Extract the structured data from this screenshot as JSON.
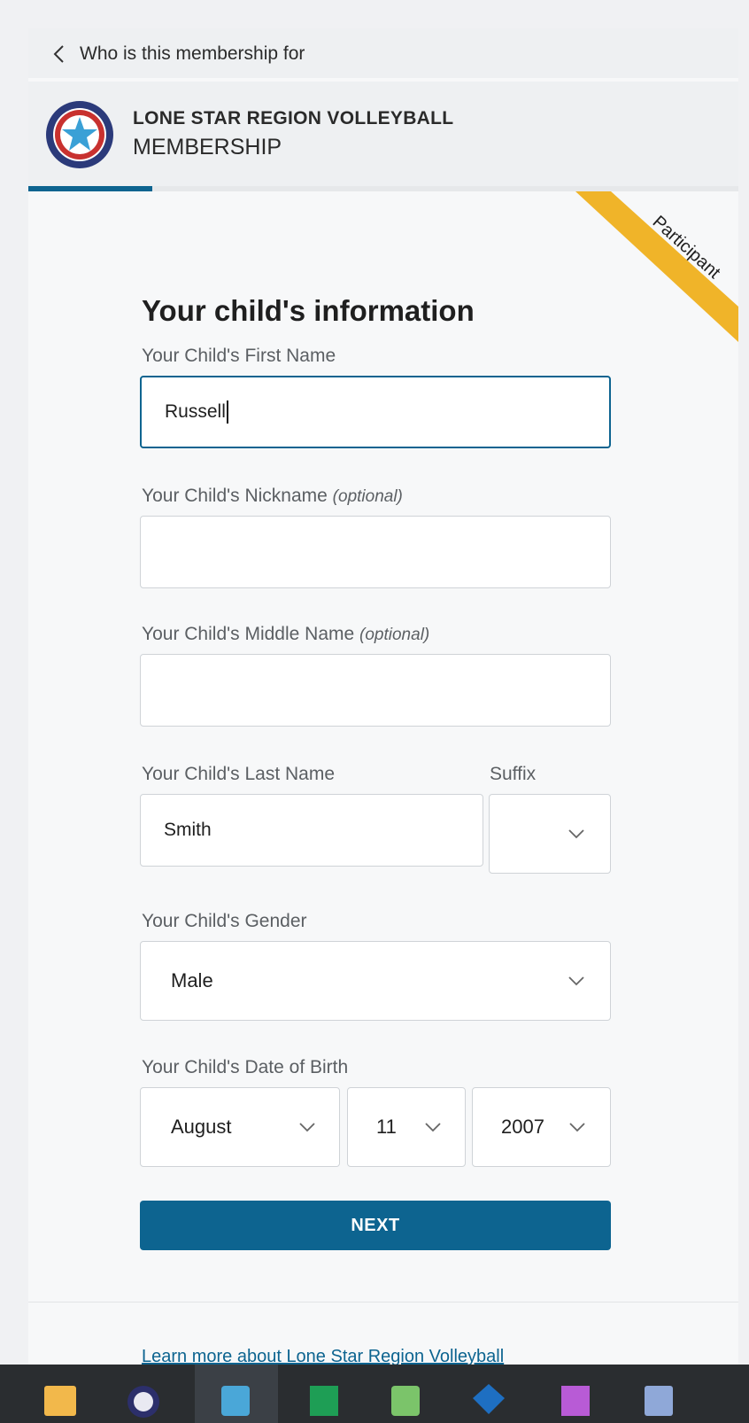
{
  "topbar": {
    "back_label": "Who is this membership for"
  },
  "org": {
    "name": "LONE STAR REGION VOLLEYBALL",
    "subtitle": "MEMBERSHIP"
  },
  "progress": {
    "fraction": 0.175
  },
  "ribbon": {
    "label": "Participant",
    "color": "#f0b429"
  },
  "form": {
    "title": "Your child's information",
    "first_name": {
      "label": "Your Child's First Name",
      "value": "Russell"
    },
    "nickname": {
      "label": "Your Child's Nickname",
      "optional": "(optional)",
      "value": ""
    },
    "middle_name": {
      "label": "Your Child's Middle Name",
      "optional": "(optional)",
      "value": ""
    },
    "last_name": {
      "label": "Your Child's Last Name",
      "value": "Smith"
    },
    "suffix": {
      "label": "Suffix",
      "value": ""
    },
    "gender": {
      "label": "Your Child's Gender",
      "value": "Male"
    },
    "dob": {
      "label": "Your Child's Date of Birth",
      "month": "August",
      "day": "11",
      "year": "2007"
    },
    "next_label": "NEXT"
  },
  "footer": {
    "learn_more": "Learn more about Lone Star Region Volleyball"
  },
  "colors": {
    "accent": "#0d6490",
    "ribbon": "#f0b429"
  },
  "taskbar": {
    "icons": [
      "folder-icon",
      "eclipse-icon",
      "code-icon",
      "table-app-icon",
      "spreadsheet-icon",
      "app-icon",
      "presentation-icon",
      "document-icon"
    ]
  }
}
